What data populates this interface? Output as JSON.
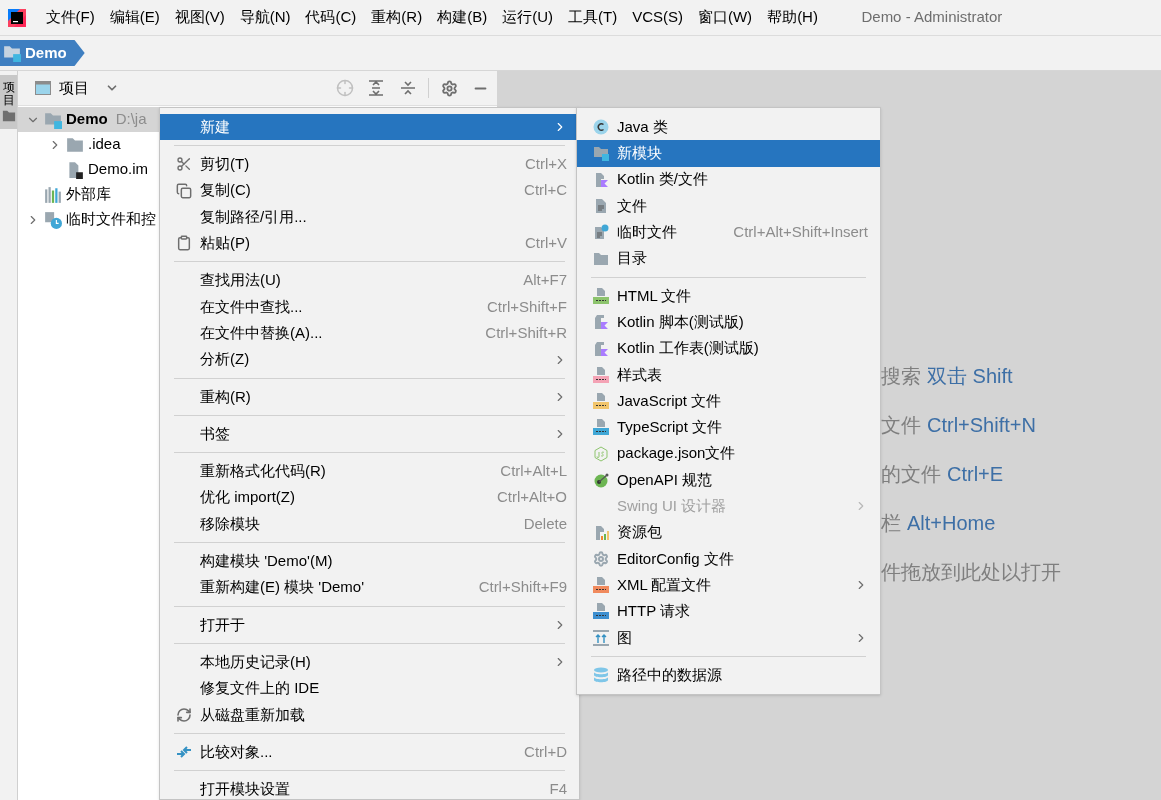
{
  "menu_bar": [
    {
      "label": "文件(F)"
    },
    {
      "label": "编辑(E)"
    },
    {
      "label": "视图(V)"
    },
    {
      "label": "导航(N)"
    },
    {
      "label": "代码(C)"
    },
    {
      "label": "重构(R)"
    },
    {
      "label": "构建(B)"
    },
    {
      "label": "运行(U)"
    },
    {
      "label": "工具(T)"
    },
    {
      "label": "VCS(S)"
    },
    {
      "label": "窗口(W)"
    },
    {
      "label": "帮助(H)"
    }
  ],
  "window": {
    "title": "Demo - Administrator"
  },
  "breadcrumb": {
    "label": "Demo"
  },
  "side_tab": {
    "label": "项目",
    "selected": true
  },
  "project_panel": {
    "title": "项目"
  },
  "tree": [
    {
      "kind": "module",
      "label": "Demo",
      "suffix": "D:\\ja",
      "expanded": true,
      "selected": true,
      "children": [
        {
          "kind": "folder",
          "label": ".idea",
          "expanded": false,
          "selected": false
        },
        {
          "kind": "file",
          "label": "Demo.im",
          "selected": false
        }
      ]
    },
    {
      "kind": "library",
      "label": "外部库",
      "selected": false
    },
    {
      "kind": "scratches",
      "label": "临时文件和控",
      "expanded": false,
      "selected": false
    }
  ],
  "context_menu": [
    {
      "kind": "item",
      "label": "新建",
      "submenu": true,
      "selected": true
    },
    {
      "kind": "separator"
    },
    {
      "kind": "item",
      "label": "剪切(T)",
      "shortcut": "Ctrl+X",
      "submenu": false,
      "selected": false
    },
    {
      "kind": "item",
      "label": "复制(C)",
      "shortcut": "Ctrl+C",
      "submenu": false,
      "selected": false
    },
    {
      "kind": "item",
      "label": "复制路径/引用...",
      "submenu": false,
      "selected": false
    },
    {
      "kind": "item",
      "label": "粘贴(P)",
      "shortcut": "Ctrl+V",
      "submenu": false,
      "selected": false
    },
    {
      "kind": "separator"
    },
    {
      "kind": "item",
      "label": "查找用法(U)",
      "shortcut": "Alt+F7",
      "submenu": false,
      "selected": false
    },
    {
      "kind": "item",
      "label": "在文件中查找...",
      "shortcut": "Ctrl+Shift+F",
      "submenu": false,
      "selected": false
    },
    {
      "kind": "item",
      "label": "在文件中替换(A)...",
      "shortcut": "Ctrl+Shift+R",
      "submenu": false,
      "selected": false
    },
    {
      "kind": "item",
      "label": "分析(Z)",
      "submenu": true,
      "selected": false
    },
    {
      "kind": "separator"
    },
    {
      "kind": "item",
      "label": "重构(R)",
      "submenu": true,
      "selected": false
    },
    {
      "kind": "separator"
    },
    {
      "kind": "item",
      "label": "书签",
      "submenu": true,
      "selected": false
    },
    {
      "kind": "separator"
    },
    {
      "kind": "item",
      "label": "重新格式化代码(R)",
      "shortcut": "Ctrl+Alt+L",
      "submenu": false,
      "selected": false
    },
    {
      "kind": "item",
      "label": "优化 import(Z)",
      "shortcut": "Ctrl+Alt+O",
      "submenu": false,
      "selected": false
    },
    {
      "kind": "item",
      "label": "移除模块",
      "shortcut": "Delete",
      "submenu": false,
      "selected": false
    },
    {
      "kind": "separator"
    },
    {
      "kind": "item",
      "label": "构建模块 'Demo'(M)",
      "submenu": false,
      "selected": false
    },
    {
      "kind": "item",
      "label": "重新构建(E) 模块 'Demo'",
      "shortcut": "Ctrl+Shift+F9",
      "submenu": false,
      "selected": false
    },
    {
      "kind": "separator"
    },
    {
      "kind": "item",
      "label": "打开于",
      "submenu": true,
      "selected": false
    },
    {
      "kind": "separator"
    },
    {
      "kind": "item",
      "label": "本地历史记录(H)",
      "submenu": true,
      "selected": false
    },
    {
      "kind": "item",
      "label": "修复文件上的 IDE",
      "submenu": false,
      "selected": false
    },
    {
      "kind": "item",
      "label": "从磁盘重新加载",
      "submenu": false,
      "selected": false
    },
    {
      "kind": "separator"
    },
    {
      "kind": "item",
      "label": "比较对象...",
      "shortcut": "Ctrl+D",
      "submenu": false,
      "selected": false
    },
    {
      "kind": "separator"
    },
    {
      "kind": "item",
      "label": "打开模块设置",
      "shortcut": "F4",
      "submenu": false,
      "selected": false
    }
  ],
  "new_submenu": [
    {
      "kind": "item",
      "label": "Java 类",
      "submenu": false,
      "selected": false,
      "disabled": false
    },
    {
      "kind": "item",
      "label": "新模块",
      "submenu": false,
      "selected": true,
      "disabled": false
    },
    {
      "kind": "item",
      "label": "Kotlin 类/文件",
      "submenu": false,
      "selected": false,
      "disabled": false
    },
    {
      "kind": "item",
      "label": "文件",
      "submenu": false,
      "selected": false,
      "disabled": false
    },
    {
      "kind": "item",
      "label": "临时文件",
      "shortcut": "Ctrl+Alt+Shift+Insert",
      "submenu": false,
      "selected": false,
      "disabled": false
    },
    {
      "kind": "item",
      "label": "目录",
      "submenu": false,
      "selected": false,
      "disabled": false
    },
    {
      "kind": "separator"
    },
    {
      "kind": "item",
      "label": "HTML 文件",
      "color": "#8dc46d",
      "submenu": false,
      "selected": false,
      "disabled": false
    },
    {
      "kind": "item",
      "label": "Kotlin 脚本(测试版)",
      "submenu": false,
      "selected": false,
      "disabled": false
    },
    {
      "kind": "item",
      "label": "Kotlin 工作表(测试版)",
      "submenu": false,
      "selected": false,
      "disabled": false
    },
    {
      "kind": "item",
      "label": "样式表",
      "color": "#f4a3b5",
      "submenu": false,
      "selected": false,
      "disabled": false
    },
    {
      "kind": "item",
      "label": "JavaScript 文件",
      "color": "#f2c56b",
      "submenu": false,
      "selected": false,
      "disabled": false
    },
    {
      "kind": "item",
      "label": "TypeScript 文件",
      "color": "#40a7d6",
      "submenu": false,
      "selected": false,
      "disabled": false
    },
    {
      "kind": "item",
      "label": "package.json文件",
      "submenu": false,
      "selected": false,
      "disabled": false
    },
    {
      "kind": "item",
      "label": "OpenAPI 规范",
      "submenu": false,
      "selected": false,
      "disabled": false
    },
    {
      "kind": "item",
      "label": "Swing UI 设计器",
      "submenu": true,
      "selected": false,
      "disabled": true
    },
    {
      "kind": "item",
      "label": "资源包",
      "submenu": false,
      "selected": false,
      "disabled": false
    },
    {
      "kind": "item",
      "label": "EditorConfig 文件",
      "submenu": false,
      "selected": false,
      "disabled": false
    },
    {
      "kind": "item",
      "label": "XML 配置文件",
      "color": "#f08a5d",
      "submenu": true,
      "selected": false,
      "disabled": false
    },
    {
      "kind": "item",
      "label": "HTTP 请求",
      "color": "#3d8fd0",
      "submenu": false,
      "selected": false,
      "disabled": false
    },
    {
      "kind": "item",
      "label": "图",
      "submenu": true,
      "selected": false,
      "disabled": false
    },
    {
      "kind": "separator"
    },
    {
      "kind": "item",
      "label": "路径中的数据源",
      "submenu": false,
      "selected": false,
      "disabled": false
    }
  ],
  "editor_hints": [
    {
      "label": "搜索",
      "shortcut": "双击 Shift"
    },
    {
      "label": "文件",
      "shortcut": "Ctrl+Shift+N"
    },
    {
      "label": "的文件",
      "shortcut": "Ctrl+E"
    },
    {
      "label": "栏",
      "shortcut": "Alt+Home"
    },
    {
      "label": "件拖放到此处以打开"
    }
  ]
}
